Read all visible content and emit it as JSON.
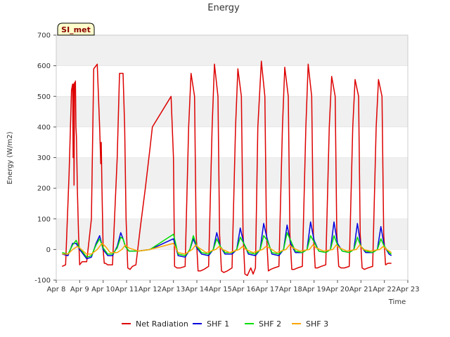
{
  "chart_data": {
    "type": "line",
    "title": "Energy",
    "xlabel": "Time",
    "ylabel": "Energy (W/m2)",
    "badge": "SI_met",
    "ylim": [
      -100,
      700
    ],
    "yticks": [
      -100,
      0,
      100,
      200,
      300,
      400,
      500,
      600,
      700
    ],
    "xlim": [
      8,
      23
    ],
    "xticks": [
      8,
      9,
      10,
      11,
      12,
      13,
      14,
      15,
      16,
      17,
      18,
      19,
      20,
      21,
      22,
      23
    ],
    "xtick_labels": [
      "Apr 8",
      "Apr 9",
      "Apr 10",
      "Apr 11",
      "Apr 12",
      "Apr 13",
      "Apr 14",
      "Apr 15",
      "Apr 16",
      "Apr 17",
      "Apr 18",
      "Apr 19",
      "Apr 20",
      "Apr 21",
      "Apr 22",
      "Apr 23"
    ],
    "x_unit": "day of April",
    "grid": "horizontal bands",
    "legend_position": "bottom",
    "series": [
      {
        "name": "Net Radiation",
        "color": "#dd0000",
        "x": [
          8.25,
          8.4,
          8.55,
          8.65,
          8.7,
          8.72,
          8.74,
          8.76,
          8.78,
          8.8,
          8.82,
          8.84,
          8.86,
          8.9,
          8.95,
          9.0,
          9.1,
          9.3,
          9.5,
          9.6,
          9.75,
          9.85,
          9.9,
          9.92,
          9.95,
          10.0,
          10.05,
          10.1,
          10.2,
          10.4,
          10.6,
          10.7,
          10.85,
          10.92,
          10.98,
          11.05,
          11.15,
          11.25,
          11.4,
          11.6,
          11.8,
          12.0,
          12.1,
          12.9,
          13.0,
          13.05,
          13.15,
          13.3,
          13.5,
          13.65,
          13.75,
          13.9,
          13.97,
          14.05,
          14.15,
          14.3,
          14.5,
          14.65,
          14.75,
          14.9,
          14.97,
          15.05,
          15.15,
          15.3,
          15.5,
          15.65,
          15.75,
          15.9,
          15.97,
          16.05,
          16.15,
          16.3,
          16.4,
          16.5,
          16.6,
          16.75,
          16.9,
          16.97,
          17.05,
          17.15,
          17.3,
          17.5,
          17.65,
          17.75,
          17.9,
          17.97,
          18.05,
          18.15,
          18.3,
          18.5,
          18.65,
          18.75,
          18.9,
          18.97,
          19.05,
          19.15,
          19.3,
          19.5,
          19.65,
          19.75,
          19.9,
          19.97,
          20.05,
          20.15,
          20.3,
          20.5,
          20.65,
          20.75,
          20.9,
          20.97,
          21.05,
          21.15,
          21.3,
          21.5,
          21.65,
          21.75,
          21.9,
          21.97,
          22.05,
          22.15,
          22.25,
          22.3
        ],
        "y": [
          -55,
          -50,
          250,
          520,
          540,
          300,
          540,
          210,
          545,
          520,
          550,
          400,
          370,
          200,
          50,
          -50,
          -40,
          -40,
          100,
          590,
          605,
          400,
          280,
          350,
          200,
          0,
          -45,
          -45,
          -50,
          -50,
          300,
          575,
          575,
          400,
          100,
          -60,
          -65,
          -55,
          -50,
          80,
          200,
          330,
          400,
          500,
          300,
          -55,
          -60,
          -60,
          -55,
          400,
          575,
          500,
          50,
          -70,
          -70,
          -65,
          -55,
          400,
          605,
          500,
          50,
          -70,
          -75,
          -70,
          -60,
          400,
          590,
          500,
          50,
          -80,
          -85,
          -60,
          -80,
          -60,
          400,
          615,
          500,
          50,
          -70,
          -65,
          -60,
          -55,
          400,
          595,
          500,
          50,
          -65,
          -65,
          -60,
          -55,
          400,
          605,
          500,
          50,
          -60,
          -60,
          -55,
          -50,
          400,
          565,
          500,
          50,
          -55,
          -60,
          -60,
          -55,
          400,
          555,
          500,
          50,
          -60,
          -65,
          -60,
          -55,
          400,
          555,
          500,
          50,
          -50,
          -45,
          -45,
          -45
        ]
      },
      {
        "name": "SHF 1",
        "color": "#0000dd",
        "x": [
          8.25,
          8.5,
          8.7,
          8.85,
          9.0,
          9.3,
          9.5,
          9.7,
          9.85,
          10.0,
          10.2,
          10.4,
          10.6,
          10.75,
          10.85,
          10.95,
          11.1,
          11.5,
          12.0,
          13.0,
          13.2,
          13.5,
          13.7,
          13.85,
          14.0,
          14.2,
          14.5,
          14.7,
          14.85,
          15.0,
          15.2,
          15.5,
          15.7,
          15.85,
          16.0,
          16.2,
          16.5,
          16.7,
          16.85,
          17.0,
          17.2,
          17.5,
          17.7,
          17.85,
          18.0,
          18.2,
          18.5,
          18.7,
          18.85,
          19.0,
          19.2,
          19.5,
          19.7,
          19.85,
          20.0,
          20.2,
          20.5,
          20.7,
          20.85,
          21.0,
          21.2,
          21.5,
          21.7,
          21.85,
          22.0,
          22.2,
          22.3
        ],
        "y": [
          -15,
          -20,
          20,
          20,
          0,
          -30,
          -25,
          20,
          45,
          0,
          -20,
          -20,
          10,
          55,
          35,
          10,
          -5,
          -5,
          0,
          35,
          -20,
          -25,
          0,
          35,
          5,
          -15,
          -20,
          0,
          55,
          10,
          -15,
          -15,
          0,
          70,
          20,
          -15,
          -20,
          0,
          85,
          35,
          -15,
          -20,
          0,
          80,
          20,
          -10,
          -10,
          0,
          90,
          30,
          -5,
          -10,
          0,
          90,
          20,
          -5,
          -10,
          0,
          85,
          10,
          -10,
          -10,
          0,
          75,
          10,
          -15,
          -20
        ]
      },
      {
        "name": "SHF 2",
        "color": "#00dd00",
        "x": [
          8.25,
          8.5,
          8.7,
          8.85,
          9.0,
          9.3,
          9.5,
          9.7,
          9.85,
          10.0,
          10.2,
          10.4,
          10.6,
          10.75,
          10.85,
          10.95,
          11.1,
          11.5,
          12.0,
          13.0,
          13.2,
          13.5,
          13.7,
          13.85,
          14.0,
          14.2,
          14.5,
          14.7,
          14.85,
          15.0,
          15.2,
          15.5,
          15.7,
          15.85,
          16.0,
          16.2,
          16.5,
          16.7,
          16.85,
          17.0,
          17.2,
          17.5,
          17.7,
          17.85,
          18.0,
          18.2,
          18.5,
          18.7,
          18.85,
          19.0,
          19.2,
          19.5,
          19.7,
          19.85,
          20.0,
          20.2,
          20.5,
          20.7,
          20.85,
          21.0,
          21.2,
          21.5,
          21.7,
          21.85,
          22.0,
          22.2,
          22.3
        ],
        "y": [
          -10,
          -15,
          15,
          30,
          5,
          -25,
          -20,
          15,
          35,
          5,
          -15,
          -15,
          5,
          40,
          35,
          10,
          -5,
          -5,
          0,
          50,
          -15,
          -20,
          0,
          45,
          10,
          -10,
          -15,
          0,
          35,
          10,
          -10,
          -10,
          0,
          40,
          20,
          -10,
          -15,
          0,
          45,
          30,
          -10,
          -15,
          0,
          55,
          30,
          -5,
          -10,
          0,
          45,
          25,
          -5,
          -10,
          0,
          45,
          15,
          -5,
          -10,
          0,
          40,
          10,
          -5,
          -10,
          0,
          35,
          10,
          -10,
          -15
        ]
      },
      {
        "name": "SHF 3",
        "color": "#ffa500",
        "x": [
          8.25,
          8.5,
          8.7,
          8.9,
          9.0,
          9.3,
          9.5,
          9.75,
          9.95,
          10.1,
          10.3,
          10.6,
          10.8,
          10.95,
          11.1,
          11.5,
          12.0,
          13.0,
          13.2,
          13.5,
          13.8,
          13.95,
          14.1,
          14.4,
          14.8,
          14.95,
          15.1,
          15.4,
          15.8,
          15.95,
          16.1,
          16.4,
          16.8,
          16.95,
          17.1,
          17.4,
          17.8,
          17.95,
          18.1,
          18.4,
          18.8,
          18.95,
          19.1,
          19.4,
          19.8,
          19.95,
          20.1,
          20.4,
          20.8,
          20.95,
          21.1,
          21.4,
          21.8,
          21.95,
          22.1,
          22.3
        ],
        "y": [
          -15,
          -15,
          0,
          10,
          5,
          -15,
          -15,
          0,
          20,
          10,
          -10,
          -10,
          0,
          15,
          5,
          -5,
          0,
          20,
          -10,
          -15,
          0,
          15,
          5,
          -10,
          0,
          10,
          0,
          -10,
          0,
          10,
          0,
          -10,
          0,
          10,
          5,
          -10,
          0,
          15,
          5,
          -5,
          0,
          15,
          5,
          -5,
          0,
          15,
          5,
          -5,
          0,
          15,
          0,
          -5,
          0,
          10,
          0,
          -10
        ]
      }
    ]
  }
}
